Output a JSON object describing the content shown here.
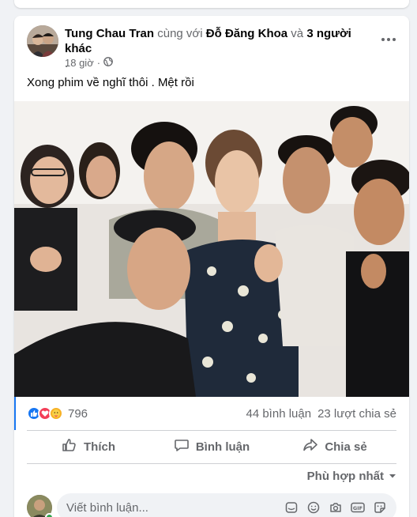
{
  "post": {
    "author": "Tung Chau Tran",
    "with_text": "cùng với",
    "tagged": "Đỗ Đăng Khoa",
    "and_text": "và",
    "others": "3 người khác",
    "trailing": ".",
    "time": "18 giờ",
    "privacy_icon": "globe-icon",
    "text": "Xong phim về nghĩ thôi . Mệt rồi"
  },
  "stats": {
    "reaction_icons": [
      "like-icon",
      "love-icon",
      "care-icon"
    ],
    "reaction_count": "796",
    "comments": "44 bình luận",
    "shares": "23 lượt chia sẻ"
  },
  "actions": {
    "like": "Thích",
    "comment": "Bình luận",
    "share": "Chia sẻ"
  },
  "comments": {
    "sort_label": "Phù hợp nhất",
    "placeholder": "Viết bình luận...",
    "input_icons": [
      "sticker-icon",
      "emoji-icon",
      "camera-icon",
      "gif-icon",
      "sticker-face-icon"
    ]
  },
  "colors": {
    "like_blue": "#1877f2",
    "love_red": "#f33e58",
    "care_yellow": "#f7b125",
    "online_green": "#31a24c",
    "muted_text": "#65676b"
  }
}
